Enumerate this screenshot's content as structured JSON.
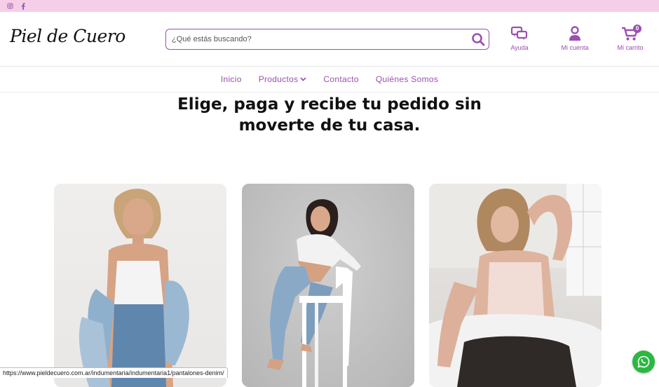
{
  "social": {
    "instagram_icon": "instagram-icon",
    "facebook_icon": "facebook-icon"
  },
  "header": {
    "logo": "Piel de Cuero",
    "search_placeholder": "¿Qué estás buscando?",
    "help_label": "Ayuda",
    "account_label": "Mi cuenta",
    "cart_label": "Mi carrito",
    "cart_count": "0"
  },
  "nav": {
    "items": [
      {
        "label": "Inicio"
      },
      {
        "label": "Productos"
      },
      {
        "label": "Contacto"
      },
      {
        "label": "Quiénes Somos"
      }
    ]
  },
  "hero": {
    "line1": "Elige, paga y recibe tu pedido sin",
    "line2": "moverte de tu casa."
  },
  "status_url": "https://www.pieldecuero.com.ar/indumentaria/indumentaria1/pantalones-denim/",
  "colors": {
    "accent": "#9c4fb0",
    "topbar": "#f5cfe8",
    "whatsapp": "#2bb741"
  }
}
